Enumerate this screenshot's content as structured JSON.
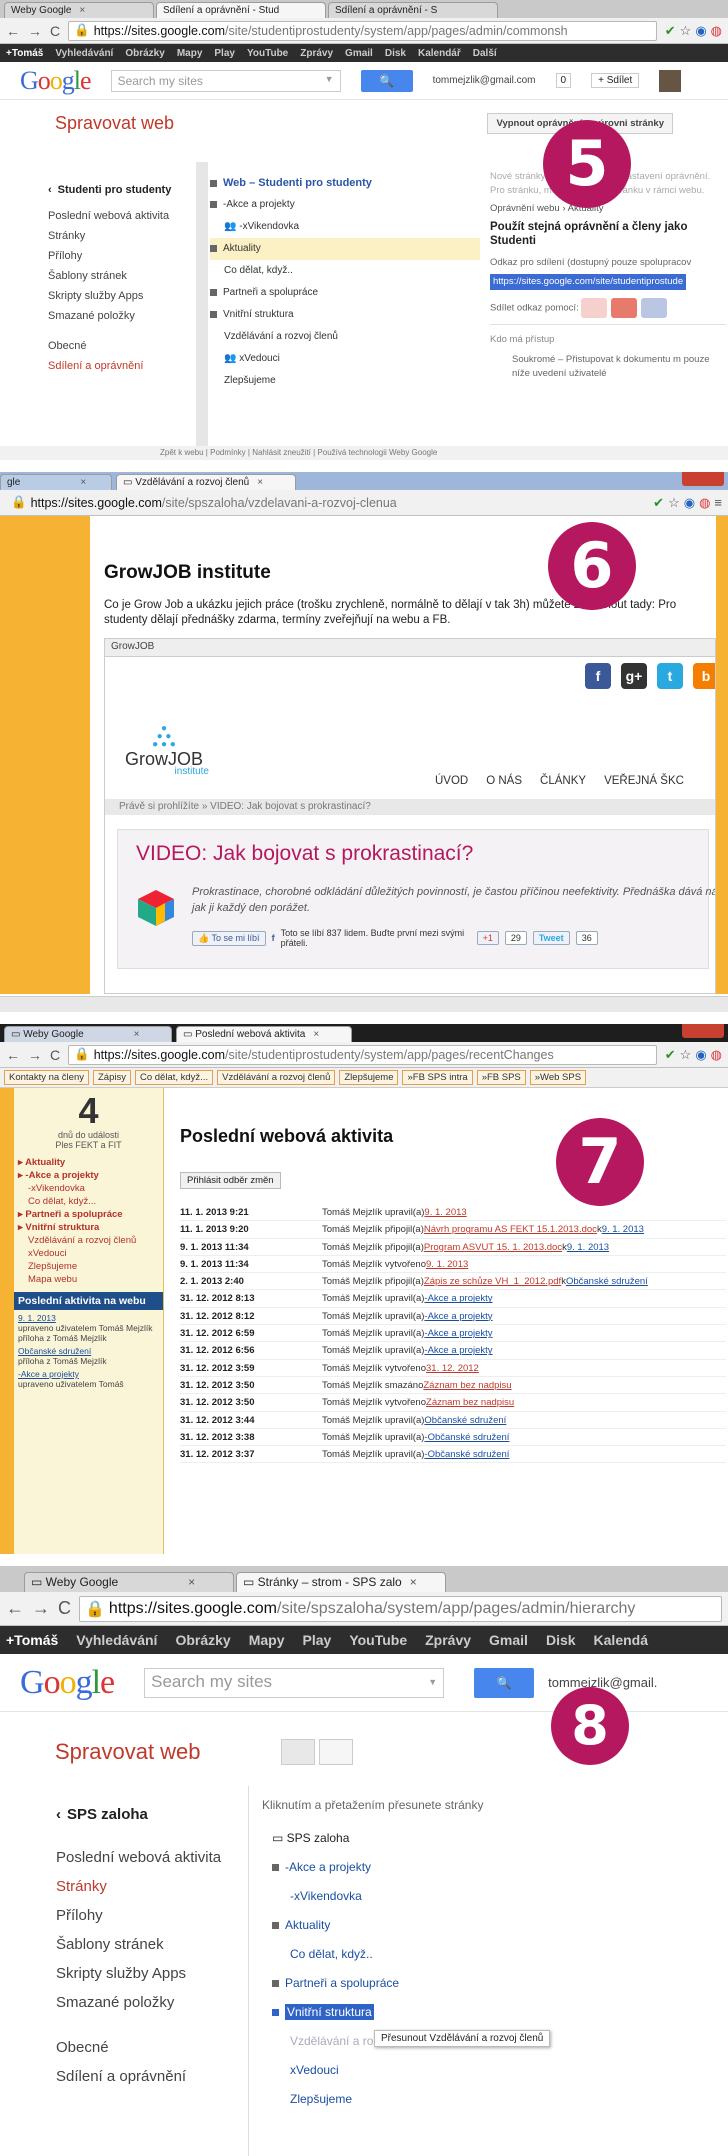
{
  "badges": {
    "b5": "5",
    "b6": "6",
    "b7": "7",
    "b8": "8"
  },
  "p5": {
    "tabs": [
      "Weby Google",
      "Sdílení a oprávnění - Stud",
      "Sdílení a oprávnění - S"
    ],
    "url_host": "https://sites.google.com",
    "url_path": "/site/studentiprostudenty/system/app/pages/admin/commonsh",
    "gbar": [
      "+Tomáš",
      "Vyhledávání",
      "Obrázky",
      "Mapy",
      "Play",
      "YouTube",
      "Zprávy",
      "Gmail",
      "Disk",
      "Kalendář",
      "Další"
    ],
    "search_placeholder": "Search my sites",
    "user": "tommejzlik@gmail.com",
    "count": "0",
    "share_btn": "+ Sdílet",
    "manage_title": "Spravovat web",
    "disable_btn": "Vypnout oprávnění na úrovni stránky",
    "site_name": "Studenti pro studenty",
    "sidebar": [
      "Poslední webová aktivita",
      "Stránky",
      "Přílohy",
      "Šablony stránek",
      "Skripty služby Apps",
      "Smazané položky"
    ],
    "sidebar2": [
      "Obecné",
      "Sdílení a oprávnění"
    ],
    "tree": [
      "Web – Studenti pro studenty",
      "-Akce a projekty",
      "-xVikendovka",
      "Aktuality",
      "Co dělat, když..",
      "Partneři a spolupráce",
      "Vnitřní struktura",
      "Vzdělávání a rozvoj členů",
      "xVedouci",
      "Zlepšujeme"
    ],
    "rp_note": "Nové stránky dědí oprávnění z nastavení oprávnění. Pro stránku, musíte přejít na stránku v rámci webu.",
    "rp_crumb": "Oprávnění webu › Aktuality",
    "rp_main": "Použít stejná oprávnění a členy jako Studenti",
    "rp_link_label": "Odkaz pro sdílení (dostupný pouze spolupracov",
    "rp_link": "https://sites.google.com/site/studentiprostude",
    "rp_share_via": "Sdílet odkaz pomocí:",
    "rp_access": "Kdo má přístup",
    "rp_private": "Soukromé – Přistupovat k dokumentu m pouze níže uvedení uživatelé",
    "footer": "Zpět k webu | Podmínky | Nahlásit zneužití | Používá technologii Weby Google"
  },
  "p6": {
    "tab": "Vzdělávání a rozvoj členů",
    "tab_left": "gle",
    "url_host": "https://sites.google.com",
    "url_path": "/site/spszaloha/vzdelavani-a-rozvoj-clenua",
    "title": "GrowJOB institute",
    "text": "Co je Grow Job a ukázku jejich práce (trošku zrychleně, normálně to dělají v tak 3h) můžete zkoounout tady: Pro studenty dělají přednášky zdarma, termíny zveřejňují na webu a FB.",
    "frame_label": "GrowJOB",
    "logo_main": "GrowJOB",
    "logo_sub": "institute",
    "nav": [
      "ÚVOD",
      "O NÁS",
      "ČLÁNKY",
      "VEŘEJNÁ ŠKC"
    ],
    "crumb": "Právě si prohlížíte » VIDEO: Jak bojovat s prokrastinací?",
    "video_title": "VIDEO: Jak bojovat s prokrastinací?",
    "video_desc": "Prokrastinace, chorobné odkládání důležitých povinností, je častou příčinou neefektivity. Přednáška dává nástroje, jak ji každý den porážet.",
    "like_btn": "To se mi líbí",
    "like_text": "Toto se líbí 837 lidem. Buďte první mezi svými přáteli.",
    "gplus": "+1",
    "gplus_count": "29",
    "tweet": "Tweet",
    "tweet_count": "36"
  },
  "p7": {
    "tabs": [
      "Weby Google",
      "Poslední webová aktivita"
    ],
    "url_host": "https://sites.google.com",
    "url_path": "/site/studentiprostudenty/system/app/pages/recentChanges",
    "bookmarks": [
      "Kontakty na členy",
      "Zápisy",
      "Co dělat, když...",
      "Vzdělávání a rozvoj členů",
      "Zlepšujeme",
      "»FB SPS intra",
      "»FB SPS",
      "»Web SPS"
    ],
    "countdown_num": "4",
    "countdown_l1": "dnů do události",
    "countdown_l2": "Ples FEKT a FIT",
    "nav": [
      "Aktuality",
      "-Akce a projekty",
      "-xVikendovka",
      "Co dělat, když...",
      "Partneři a spolupráce",
      "Vnitřní struktura",
      "Vzdělávání a rozvoj členů",
      "xVedouci",
      "Zlepšujeme",
      "Mapa webu"
    ],
    "activity_box": "Poslední aktivita na webu",
    "activity_list": [
      {
        "link": "9. 1. 2013",
        "text": "upraveno uživatelem Tomáš Mejzlík"
      },
      {
        "link": "",
        "text": "příloha z Tomáš Mejzlík"
      },
      {
        "link": "Občanské sdružení",
        "text": "příloha z Tomáš Mejzlík"
      },
      {
        "link": "-Akce a projekty",
        "text": "upraveno uživatelem Tomáš"
      }
    ],
    "page_title": "Poslední webová aktivita",
    "subscribe_btn": "Přihlásit odběr změn",
    "rows": [
      {
        "d": "11. 1. 2013 9:21",
        "u": "Tomáš Mejzlík upravil(a) ",
        "l1": "9. 1. 2013",
        "m": "",
        "l2": ""
      },
      {
        "d": "11. 1. 2013 9:20",
        "u": "Tomáš Mejzlík připojil(a) ",
        "l1": "Návrh programu AS FEKT 15.1.2013.doc",
        "m": " k ",
        "l2": "9. 1. 2013"
      },
      {
        "d": "9. 1. 2013 11:34",
        "u": "Tomáš Mejzlík připojil(a) ",
        "l1": "Program ASVUT 15. 1. 2013.doc",
        "m": " k ",
        "l2": "9. 1. 2013"
      },
      {
        "d": "9. 1. 2013 11:34",
        "u": "Tomáš Mejzlík vytvořeno ",
        "l1": "9. 1. 2013",
        "m": "",
        "l2": ""
      },
      {
        "d": "2. 1. 2013 2:40",
        "u": "Tomáš Mejzlík připojil(a) ",
        "l1": "Zápis ze schůze VH_1_2012.pdf",
        "m": " k ",
        "l2": "Občanské sdružení"
      },
      {
        "d": "31. 12. 2012 8:13",
        "u": "Tomáš Mejzlík upravil(a) ",
        "l1": "-Akce a projekty",
        "m": "",
        "l2": ""
      },
      {
        "d": "31. 12. 2012 8:12",
        "u": "Tomáš Mejzlík upravil(a) ",
        "l1": "-Akce a projekty",
        "m": "",
        "l2": ""
      },
      {
        "d": "31. 12. 2012 6:59",
        "u": "Tomáš Mejzlík upravil(a) ",
        "l1": "-Akce a projekty",
        "m": "",
        "l2": ""
      },
      {
        "d": "31. 12. 2012 6:56",
        "u": "Tomáš Mejzlík upravil(a) ",
        "l1": "-Akce a projekty",
        "m": "",
        "l2": ""
      },
      {
        "d": "31. 12. 2012 3:59",
        "u": "Tomáš Mejzlík vytvořeno ",
        "l1": "31. 12. 2012",
        "m": "",
        "l2": ""
      },
      {
        "d": "31. 12. 2012 3:50",
        "u": "Tomáš Mejzlík smazáno ",
        "l1": "Záznam bez nadpisu",
        "m": "",
        "l2": ""
      },
      {
        "d": "31. 12. 2012 3:50",
        "u": "Tomáš Mejzlík vytvořeno ",
        "l1": "Záznam bez nadpisu",
        "m": "",
        "l2": ""
      },
      {
        "d": "31. 12. 2012 3:44",
        "u": "Tomáš Mejzlík upravil(a) ",
        "l1": "Občanské sdružení",
        "m": "",
        "l2": ""
      },
      {
        "d": "31. 12. 2012 3:38",
        "u": "Tomáš Mejzlík upravil(a) ",
        "l1": "-Občanské sdružení",
        "m": "",
        "l2": ""
      },
      {
        "d": "31. 12. 2012 3:37",
        "u": "Tomáš Mejzlík upravil(a) ",
        "l1": "-Občanské sdružení",
        "m": "",
        "l2": ""
      }
    ]
  },
  "p8": {
    "tabs": [
      "Weby Google",
      "Stránky – strom - SPS zalo"
    ],
    "url_host": "https://sites.google.com",
    "url_path": "/site/spszaloha/system/app/pages/admin/hierarchy",
    "gbar": [
      "+Tomáš",
      "Vyhledávání",
      "Obrázky",
      "Mapy",
      "Play",
      "YouTube",
      "Zprávy",
      "Gmail",
      "Disk",
      "Kalendá"
    ],
    "search_placeholder": "Search my sites",
    "user": "tommejzlik@gmail.",
    "manage_title": "Spravovat web",
    "site_name": "SPS zaloha",
    "sidebar": [
      "Poslední webová aktivita",
      "Stránky",
      "Přílohy",
      "Šablony stránek",
      "Skripty služby Apps",
      "Smazané položky"
    ],
    "sidebar2": [
      "Obecné",
      "Sdílení a oprávnění"
    ],
    "hint": "Kliknutím a přetažením přesunete stránky",
    "tree": [
      "SPS zaloha",
      "-Akce a projekty",
      "-xVikendovka",
      "Aktuality",
      "Co dělat, když..",
      "Partneři a spolupráce",
      "Vnitřní struktura",
      "Vzdělávání a rozvoj",
      "xVedouci",
      "Zlepšujeme"
    ],
    "tooltip": "Přesunout Vzdělávání a rozvoj členů"
  }
}
